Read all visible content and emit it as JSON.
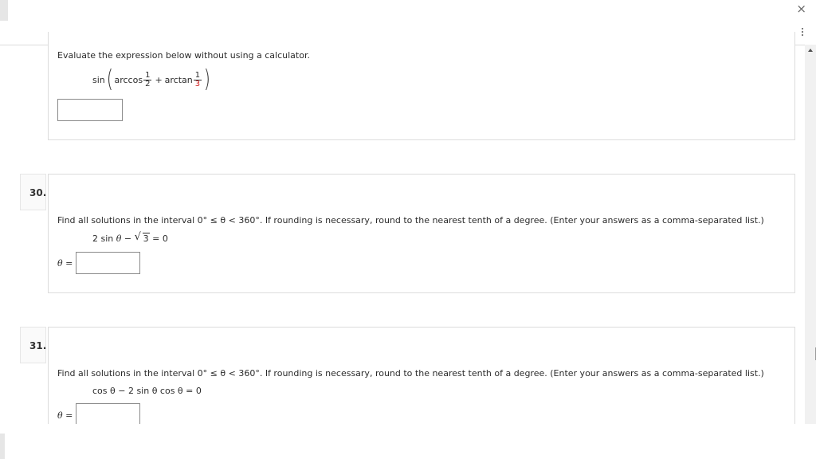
{
  "window": {
    "close_glyph": "×"
  },
  "questions": [
    {
      "number": "",
      "prompt": "Evaluate the expression below without using a calculator.",
      "expression": {
        "func": "sin",
        "inner_1": "arccos",
        "frac1_num": "1",
        "frac1_den": "2",
        "plus": "+",
        "inner_2": "arctan",
        "frac2_num": "1",
        "frac2_den": "3"
      },
      "answer_value": ""
    },
    {
      "number": "30.",
      "prompt": "Find all solutions in the interval  0° ≤ θ < 360°.  If rounding is necessary, round to the nearest tenth of a degree. (Enter your answers as a comma-separated list.)",
      "equation_left": "2 sin ",
      "equation_theta": "θ",
      "equation_minus": " − ",
      "equation_radicand": "3",
      "equation_right": " = 0",
      "answer_label_symbol": "θ",
      "answer_label_eq": " =",
      "answer_value": ""
    },
    {
      "number": "31.",
      "prompt": "Find all solutions in the interval  0° ≤ θ < 360°.  If rounding is necessary, round to the nearest tenth of a degree. (Enter your answers as a comma-separated list.)",
      "equation": "cos θ − 2 sin θ cos θ = 0",
      "answer_label_symbol": "θ",
      "answer_label_eq": " =",
      "answer_value": ""
    }
  ]
}
